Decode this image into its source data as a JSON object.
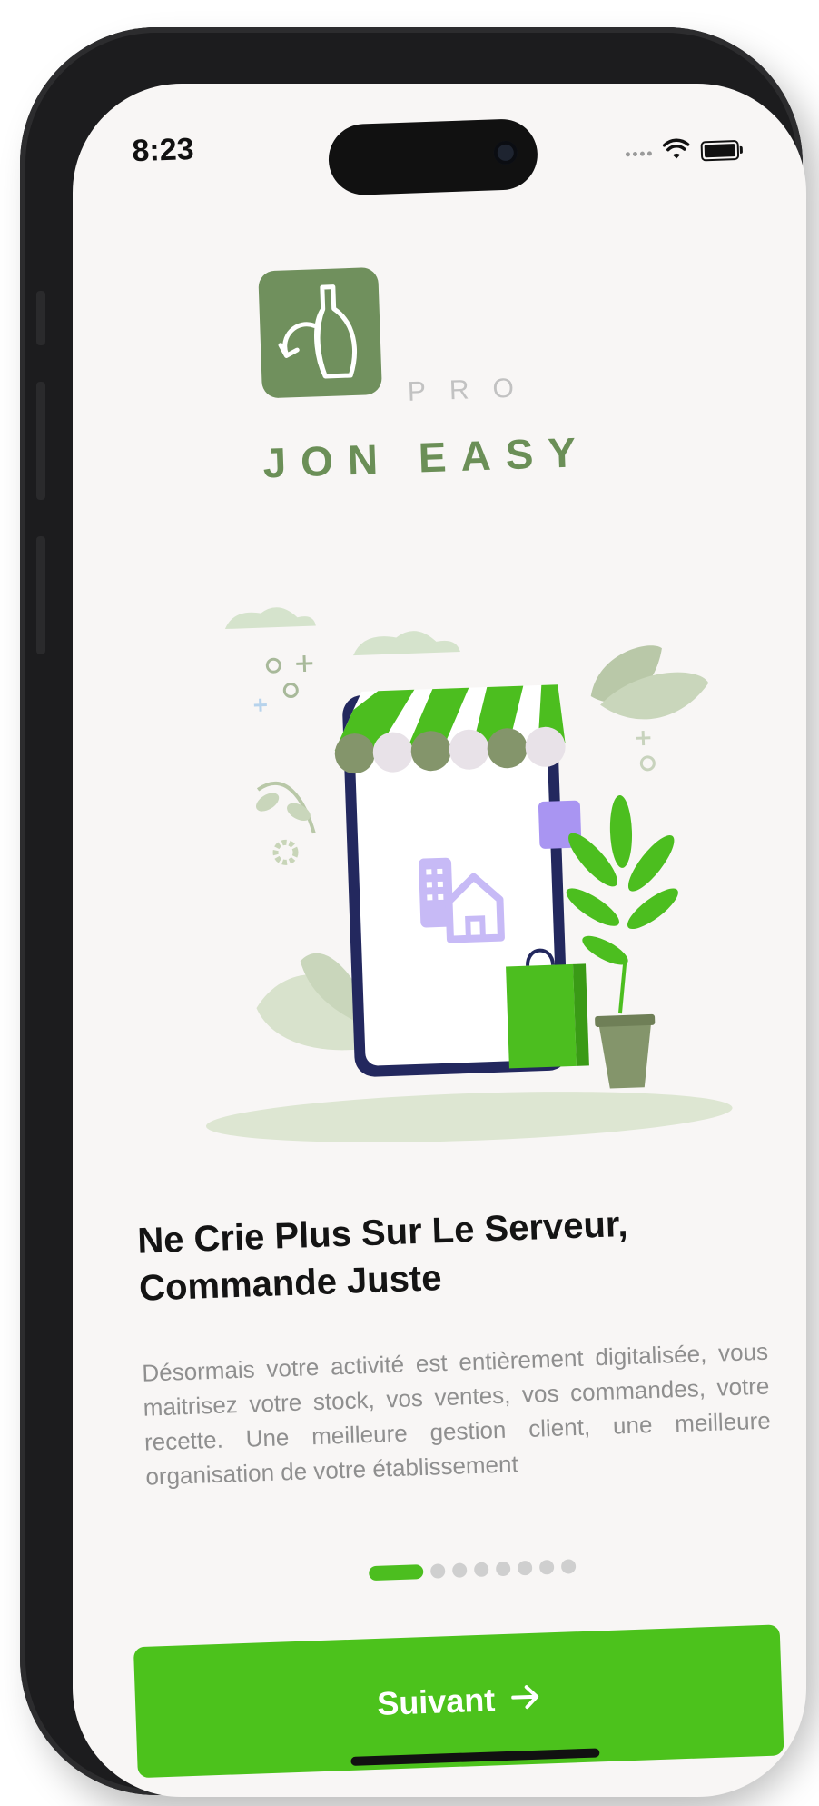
{
  "status_bar": {
    "time": "8:23"
  },
  "brand": {
    "pro": "PRO",
    "name": "JON EASY",
    "accent": "#6b8f57",
    "logo_icon": "bottle-refresh-icon"
  },
  "illustration": {
    "name": "mobile-shop-illustration",
    "colors": {
      "green": "#4cbe1f",
      "navy": "#23285e",
      "lavender": "#a995f2",
      "sage": "#d7e4cc"
    }
  },
  "onboarding": {
    "title": "Ne Crie Plus Sur Le Serveur, Commande Juste",
    "description": "Désormais votre activité est entièrement digitalisée, vous maitrisez votre stock, vos ventes, vos commandes, votre recette. Une meilleure gestion client, une meilleure organisation de votre établissement",
    "page_indicator": {
      "current": 1,
      "total": 8
    }
  },
  "actions": {
    "next_label": "Suivant",
    "next_icon": "arrow-right-icon",
    "button_color": "#4cc21c"
  }
}
